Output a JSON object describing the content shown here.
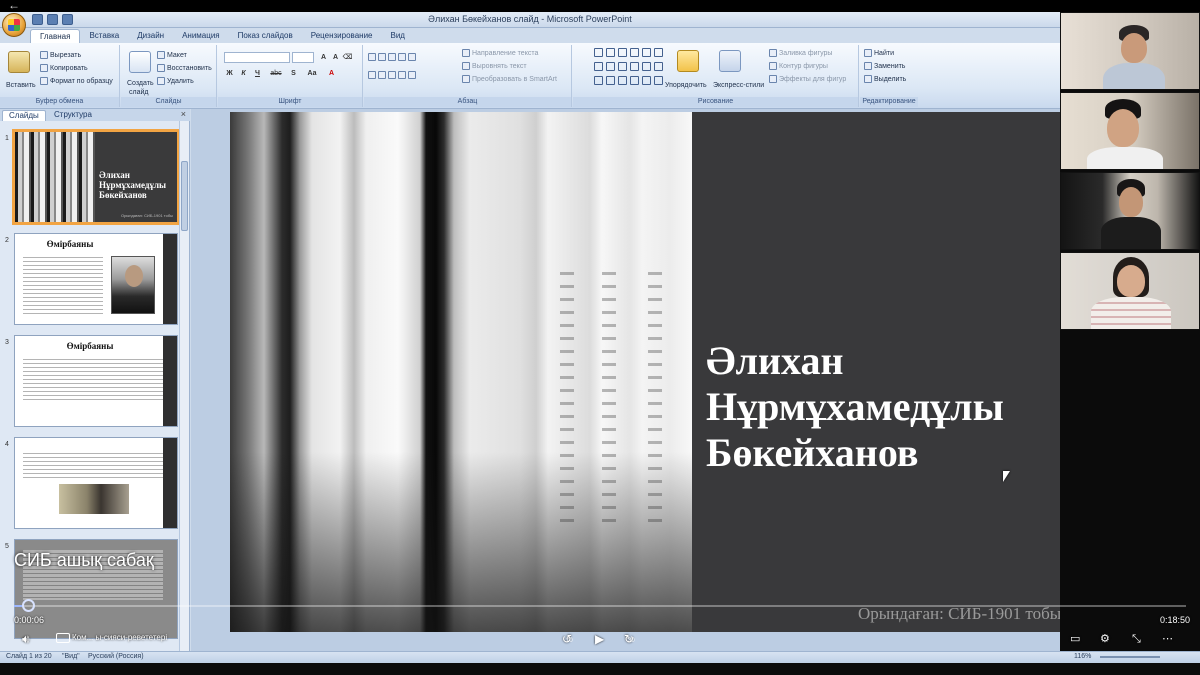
{
  "window": {
    "title": "Әлихан Бөкейханов слайд - Microsoft PowerPoint"
  },
  "ribbon": {
    "tabs": [
      {
        "label": "Главная",
        "active": true
      },
      {
        "label": "Вставка"
      },
      {
        "label": "Дизайн"
      },
      {
        "label": "Анимация"
      },
      {
        "label": "Показ слайдов"
      },
      {
        "label": "Рецензирование"
      },
      {
        "label": "Вид"
      }
    ],
    "clipboard": {
      "paste": "Вставить",
      "cut": "Вырезать",
      "copy": "Копировать",
      "format_painter": "Формат по образцу",
      "group_label": "Буфер обмена"
    },
    "slides": {
      "new_slide_1": "Создать",
      "new_slide_2": "слайд",
      "layout": "Макет",
      "reset": "Восстановить",
      "delete": "Удалить",
      "group_label": "Слайды"
    },
    "font": {
      "group_label": "Шрифт",
      "bold": "Ж",
      "italic": "К",
      "underline": "Ч",
      "strike": "abc",
      "spacing": "S",
      "aa": "Aa"
    },
    "paragraph": {
      "text_direction": "Направление текста",
      "align_text": "Выровнять текст",
      "smartart": "Преобразовать в SmartArt",
      "group_label": "Абзац"
    },
    "drawing": {
      "arrange": "Упорядочить",
      "quick_styles": "Экспресс-стили",
      "shape_fill": "Заливка фигуры",
      "shape_outline": "Контур фигуры",
      "shape_effects": "Эффекты для фигур",
      "group_label": "Рисование"
    },
    "editing": {
      "find": "Найти",
      "replace": "Заменить",
      "select": "Выделить",
      "group_label": "Редактирование"
    }
  },
  "panel": {
    "tab_slides": "Слайды",
    "tab_outline": "Структура",
    "close": "×",
    "thumbnails": [
      {
        "num": "1",
        "title_lines": [
          "Әлихан",
          "Нұрмұхамедұлы",
          "Бөкейханов"
        ],
        "caption": "Орындаған: СИБ-1901 тобы",
        "selected": true
      },
      {
        "num": "2",
        "title": "Өмірбаяны"
      },
      {
        "num": "3",
        "title": "Өмірбаяны"
      },
      {
        "num": "4"
      },
      {
        "num": "5"
      }
    ]
  },
  "slide": {
    "title_lines": [
      "Әлихан",
      "Нұрмұхамедұлы",
      "Бөкейханов"
    ],
    "caption": "Орындаған: СИБ-1901 тобы"
  },
  "statusbar": {
    "slide_info": "Слайд 1 из 20",
    "theme": "\"Вид\"",
    "language": "Русский (Россия)",
    "zoom": "116%"
  },
  "player": {
    "title": "СИБ ашық сабақ",
    "current_time": "0:00:06",
    "total_time": "0:18:50",
    "progress": 0.006,
    "subtitle_text": "Ком... ы-сияси-ревететері",
    "skip_back": "10",
    "skip_forward": "30"
  },
  "icons": {
    "back": "back-arrow-icon",
    "volume": "volume-icon",
    "captions": "captions-icon",
    "rewind": "rewind-10-icon",
    "play": "play-icon",
    "forward": "forward-30-icon",
    "screen": "screen-icon",
    "speed": "speed-icon",
    "collapse": "collapse-icon",
    "more": "more-icon"
  }
}
